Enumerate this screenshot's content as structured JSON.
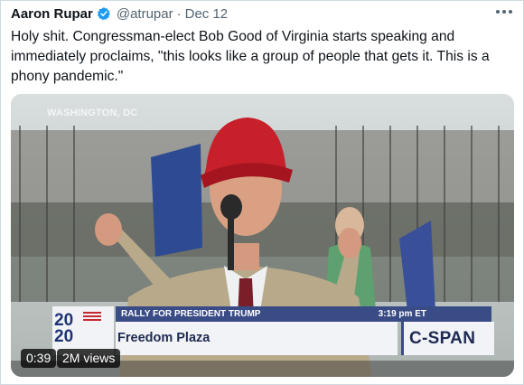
{
  "tweet": {
    "author_name": "Aaron Rupar",
    "handle": "@atrupar",
    "separator": "·",
    "date": "Dec 12",
    "text": "Holy shit. Congressman-elect Bob Good of Virginia starts speaking and immediately proclaims, \"this looks like a group of people that gets it. This is a phony pandemic.\""
  },
  "video": {
    "location_bug": "WASHINGTON, DC",
    "lower_third": {
      "event": "RALLY FOR PRESIDENT TRUMP",
      "time": "3:19 pm ET",
      "place": "Freedom Plaza",
      "network": "C-SPAN",
      "logo_top": "20",
      "logo_bottom": "20"
    },
    "duration": "0:39",
    "views": "2M views"
  },
  "colors": {
    "verified": "#1d9bf0",
    "secondary_text": "#536471",
    "lower_third_blue": "#3a4c86",
    "hat_red": "#c8202a"
  },
  "icons": {
    "verified": "verified-badge-icon",
    "more": "more-options-icon"
  }
}
